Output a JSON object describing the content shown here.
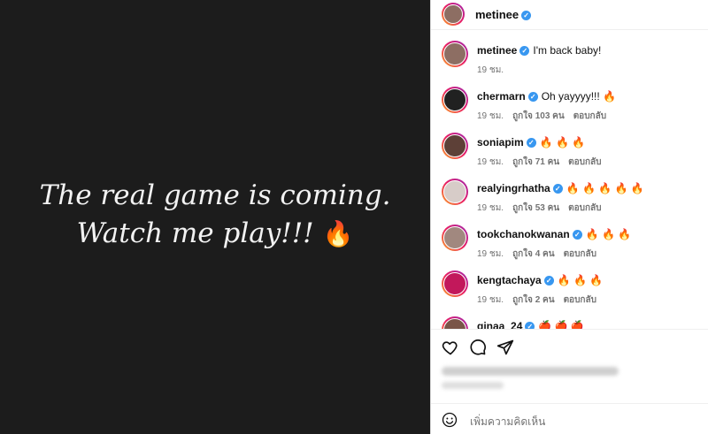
{
  "post": {
    "text_line1": "The real game is coming.",
    "text_line2": "Watch me play!!!",
    "emoji": "🔥"
  },
  "header": {
    "username": "metinee"
  },
  "comments": [
    {
      "username": "metinee",
      "text": "I'm back baby!",
      "time": "19 ชม.",
      "likes": "",
      "reply": "",
      "avatar_color": "#8d6e63"
    },
    {
      "username": "chermarn",
      "text": "Oh yayyyy!!! 🔥",
      "time": "19 ชม.",
      "likes": "ถูกใจ 103 คน",
      "reply": "ตอบกลับ",
      "avatar_color": "#212121"
    },
    {
      "username": "soniapim",
      "text": "🔥 🔥 🔥",
      "time": "19 ชม.",
      "likes": "ถูกใจ 71 คน",
      "reply": "ตอบกลับ",
      "avatar_color": "#5d4037"
    },
    {
      "username": "realyingrhatha",
      "text": "🔥 🔥 🔥 🔥 🔥",
      "time": "19 ชม.",
      "likes": "ถูกใจ 53 คน",
      "reply": "ตอบกลับ",
      "avatar_color": "#d7ccc8"
    },
    {
      "username": "tookchanokwanan",
      "text": "🔥 🔥 🔥",
      "time": "19 ชม.",
      "likes": "ถูกใจ 4 คน",
      "reply": "ตอบกลับ",
      "avatar_color": "#a1887f"
    },
    {
      "username": "kengtachaya",
      "text": "🔥 🔥 🔥",
      "time": "19 ชม.",
      "likes": "ถูกใจ 2 คน",
      "reply": "ตอบกลับ",
      "avatar_color": "#c2185b"
    },
    {
      "username": "ginaa_24",
      "text": "🍎 🍎 🍎",
      "time": "",
      "likes": "",
      "reply": "",
      "avatar_color": "#795548"
    }
  ],
  "add_comment": {
    "placeholder": "เพิ่มความคิดเห็น"
  },
  "icons": {
    "like": "heart-icon",
    "comment": "comment-icon",
    "share": "share-icon",
    "emoji": "smiley-icon",
    "verified": "verified-badge-icon"
  },
  "colors": {
    "verified": "#3897f0",
    "dark_bg": "#1c1c1c"
  }
}
